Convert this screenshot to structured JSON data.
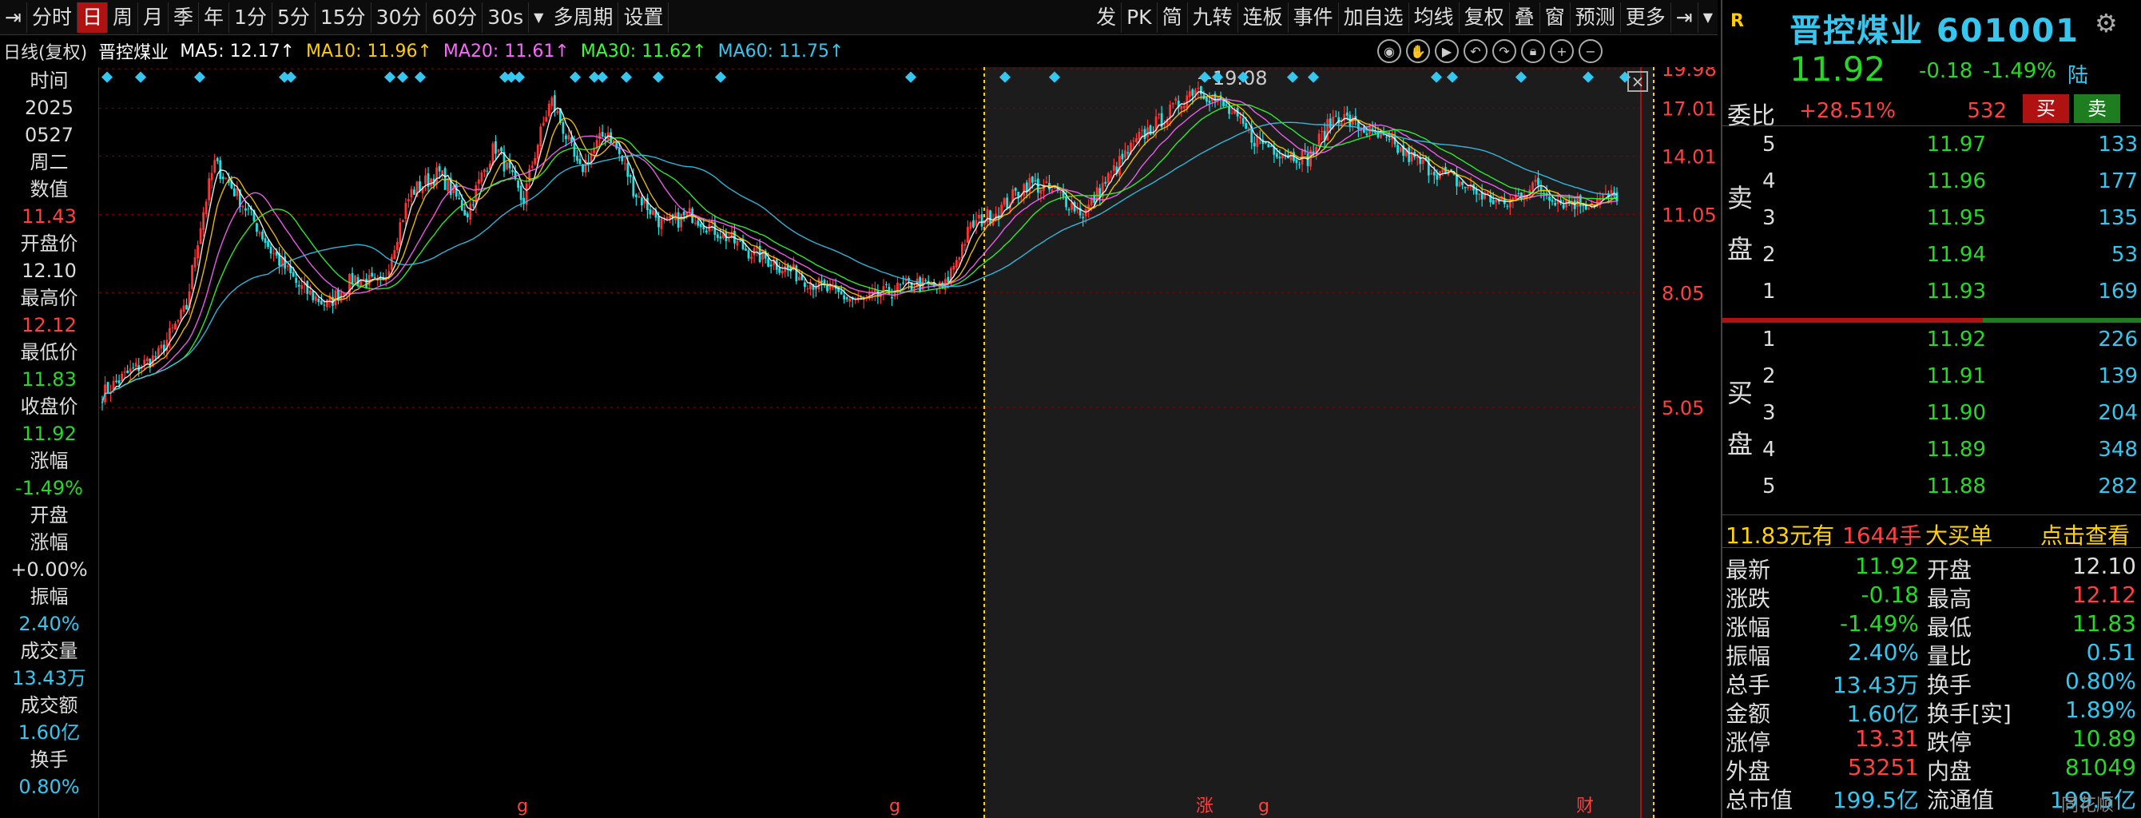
{
  "toolbar": {
    "left_icon": "⇥",
    "periods": [
      "分时",
      "日",
      "周",
      "月",
      "季",
      "年",
      "1分",
      "5分",
      "15分",
      "30分",
      "60分",
      "30s"
    ],
    "active_period": "日",
    "more_periods": "多周期",
    "settings": "设置",
    "right_items": [
      "发",
      "PK",
      "简",
      "九转",
      "连板",
      "事件",
      "加自选",
      "均线",
      "复权",
      "叠",
      "窗",
      "预测",
      "更多"
    ],
    "collapse_icon": "⇥"
  },
  "ma_row": {
    "prefix": "日线(复权)",
    "name": "晋控煤业",
    "ma5": "MA5: 12.17↑",
    "ma10": "MA10: 11.96↑",
    "ma20": "MA20: 11.61↑",
    "ma30": "MA30: 11.62↑",
    "ma60": "MA60: 11.75↑"
  },
  "left_panel": [
    {
      "t": "时间",
      "c": "#dddddd"
    },
    {
      "t": "2025",
      "c": "#dddddd"
    },
    {
      "t": "0527",
      "c": "#dddddd"
    },
    {
      "t": "周二",
      "c": "#dddddd"
    },
    {
      "t": "数值",
      "c": "#dddddd"
    },
    {
      "t": "11.43",
      "c": "#ff4040"
    },
    {
      "t": "开盘价",
      "c": "#dddddd"
    },
    {
      "t": "12.10",
      "c": "#dddddd"
    },
    {
      "t": "最高价",
      "c": "#dddddd"
    },
    {
      "t": "12.12",
      "c": "#ff4040"
    },
    {
      "t": "最低价",
      "c": "#dddddd"
    },
    {
      "t": "11.83",
      "c": "#26d926"
    },
    {
      "t": "收盘价",
      "c": "#dddddd"
    },
    {
      "t": "11.92",
      "c": "#26d926"
    },
    {
      "t": "涨幅",
      "c": "#dddddd"
    },
    {
      "t": "-1.49%",
      "c": "#26d926"
    },
    {
      "t": "开盘",
      "c": "#dddddd"
    },
    {
      "t": "涨幅",
      "c": "#dddddd"
    },
    {
      "t": "+0.00%",
      "c": "#dddddd"
    },
    {
      "t": "振幅",
      "c": "#dddddd"
    },
    {
      "t": "2.40%",
      "c": "#35c7f0"
    },
    {
      "t": "成交量",
      "c": "#dddddd"
    },
    {
      "t": "13.43万",
      "c": "#35c7f0"
    },
    {
      "t": "成交额",
      "c": "#dddddd"
    },
    {
      "t": "1.60亿",
      "c": "#35c7f0"
    },
    {
      "t": "换手",
      "c": "#dddddd"
    },
    {
      "t": "0.80%",
      "c": "#35c7f0"
    }
  ],
  "chart_data": {
    "type": "candlestick",
    "ylabels": [
      "19.98",
      "17.01",
      "14.01",
      "11.05",
      "8.05",
      "5.05"
    ],
    "yticks": [
      19.98,
      17.01,
      14.01,
      11.05,
      8.05,
      5.05
    ],
    "ylog": true,
    "high_marker": "19.08",
    "bottom_markers": [
      "g",
      "g",
      "涨",
      "g",
      "财"
    ],
    "key_closes": [
      5.3,
      5.8,
      6.2,
      7.5,
      13.5,
      11.5,
      9.5,
      8.2,
      7.6,
      8.5,
      8.2,
      12.0,
      13.0,
      11.0,
      14.5,
      11.5,
      17.5,
      13.0,
      15.5,
      12.0,
      10.5,
      11.0,
      10.2,
      9.5,
      9.0,
      8.5,
      8.0,
      7.7,
      8.0,
      8.3,
      8.1,
      10.5,
      11.2,
      12.5,
      12.0,
      11.0,
      13.0,
      15.0,
      16.5,
      18.5,
      17.0,
      15.0,
      14.2,
      13.8,
      16.5,
      15.5,
      14.5,
      13.5,
      12.8,
      12.0,
      11.4,
      12.4,
      11.6,
      11.5,
      11.9
    ]
  },
  "right_panel": {
    "tag_r": "R",
    "title": "晋控煤业 601001",
    "price": "11.92",
    "change": "-0.18",
    "pct": "-1.49%",
    "tag": "陆",
    "webi_label": "委比",
    "webi_value": "+28.51%",
    "webi_diff": "532",
    "buy_btn": "买",
    "sell_btn": "卖",
    "sell_label": "卖盘",
    "buy_label": "买盘",
    "asks": [
      {
        "i": "5",
        "p": "11.97",
        "v": "133"
      },
      {
        "i": "4",
        "p": "11.96",
        "v": "177"
      },
      {
        "i": "3",
        "p": "11.95",
        "v": "135"
      },
      {
        "i": "2",
        "p": "11.94",
        "v": "53"
      },
      {
        "i": "1",
        "p": "11.93",
        "v": "169"
      }
    ],
    "bids": [
      {
        "i": "1",
        "p": "11.92",
        "v": "226"
      },
      {
        "i": "2",
        "p": "11.91",
        "v": "139"
      },
      {
        "i": "3",
        "p": "11.90",
        "v": "204"
      },
      {
        "i": "4",
        "p": "11.89",
        "v": "348"
      },
      {
        "i": "5",
        "p": "11.88",
        "v": "282"
      }
    ],
    "bigorder": {
      "price": "11.83元有",
      "vol": "1644手",
      "tag": "大买单",
      "link": "点击查看"
    },
    "stats": [
      {
        "k1": "最新",
        "v1": "11.92",
        "c1": "#26d926",
        "k2": "开盘",
        "v2": "12.10",
        "c2": "#dddddd"
      },
      {
        "k1": "涨跌",
        "v1": "-0.18",
        "c1": "#26d926",
        "k2": "最高",
        "v2": "12.12",
        "c2": "#ff4040"
      },
      {
        "k1": "涨幅",
        "v1": "-1.49%",
        "c1": "#26d926",
        "k2": "最低",
        "v2": "11.83",
        "c2": "#26d926"
      },
      {
        "k1": "振幅",
        "v1": "2.40%",
        "c1": "#35c7f0",
        "k2": "量比",
        "v2": "0.51",
        "c2": "#35c7f0"
      },
      {
        "k1": "总手",
        "v1": "13.43万",
        "c1": "#35c7f0",
        "k2": "换手",
        "v2": "0.80%",
        "c2": "#35c7f0"
      },
      {
        "k1": "金额",
        "v1": "1.60亿",
        "c1": "#35c7f0",
        "k2": "换手[实]",
        "v2": "1.89%",
        "c2": "#35c7f0"
      },
      {
        "k1": "涨停",
        "v1": "13.31",
        "c1": "#ff4040",
        "k2": "跌停",
        "v2": "10.89",
        "c2": "#26d926"
      },
      {
        "k1": "外盘",
        "v1": "53251",
        "c1": "#ff4040",
        "k2": "内盘",
        "v2": "81049",
        "c2": "#26d926"
      },
      {
        "k1": "总市值",
        "v1": "199.5亿",
        "c1": "#35c7f0",
        "k2": "流通值",
        "v2": "199.5亿",
        "c2": "#35c7f0"
      }
    ],
    "watermark": "同花顺F10"
  },
  "colors": {
    "up": "#ff3333",
    "down": "#22e0e0",
    "ma5": "#ffffff",
    "ma10": "#ffcc00",
    "ma20": "#ff66ff",
    "ma30": "#33ff33",
    "ma60": "#35c7f0",
    "grid": "#8b0000"
  }
}
